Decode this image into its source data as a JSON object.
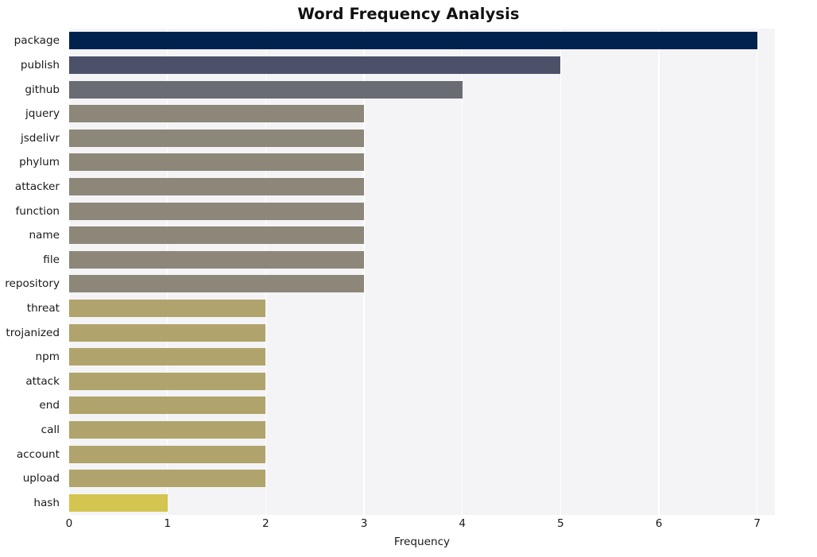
{
  "chart_data": {
    "type": "bar",
    "orientation": "horizontal",
    "title": "Word Frequency Analysis",
    "xlabel": "Frequency",
    "ylabel": "",
    "categories": [
      "package",
      "publish",
      "github",
      "jquery",
      "jsdelivr",
      "phylum",
      "attacker",
      "function",
      "name",
      "file",
      "repository",
      "threat",
      "trojanized",
      "npm",
      "attack",
      "end",
      "call",
      "account",
      "upload",
      "hash"
    ],
    "values": [
      7,
      5,
      4,
      3,
      3,
      3,
      3,
      3,
      3,
      3,
      3,
      2,
      2,
      2,
      2,
      2,
      2,
      2,
      2,
      1
    ],
    "bar_colors": [
      "#00224e",
      "#4b5169",
      "#6a6c73",
      "#8c8779",
      "#8c8779",
      "#8c8779",
      "#8c8779",
      "#8c8779",
      "#8c8779",
      "#8c8779",
      "#8c8779",
      "#b0a46c",
      "#b0a46c",
      "#b0a46c",
      "#b0a46c",
      "#b0a46c",
      "#b0a46c",
      "#b0a46c",
      "#b0a46c",
      "#d4c450"
    ],
    "xlim": [
      0,
      7.18
    ],
    "xticks": [
      0,
      1,
      2,
      3,
      4,
      5,
      6,
      7
    ],
    "xtick_labels": [
      "0",
      "1",
      "2",
      "3",
      "4",
      "5",
      "6",
      "7"
    ],
    "grid": "vertical-only",
    "legend": "none",
    "colormap": "cividis",
    "plot_background": "#f4f4f6",
    "gridline_color": "#ffffff",
    "figure_background": "#ffffff"
  }
}
